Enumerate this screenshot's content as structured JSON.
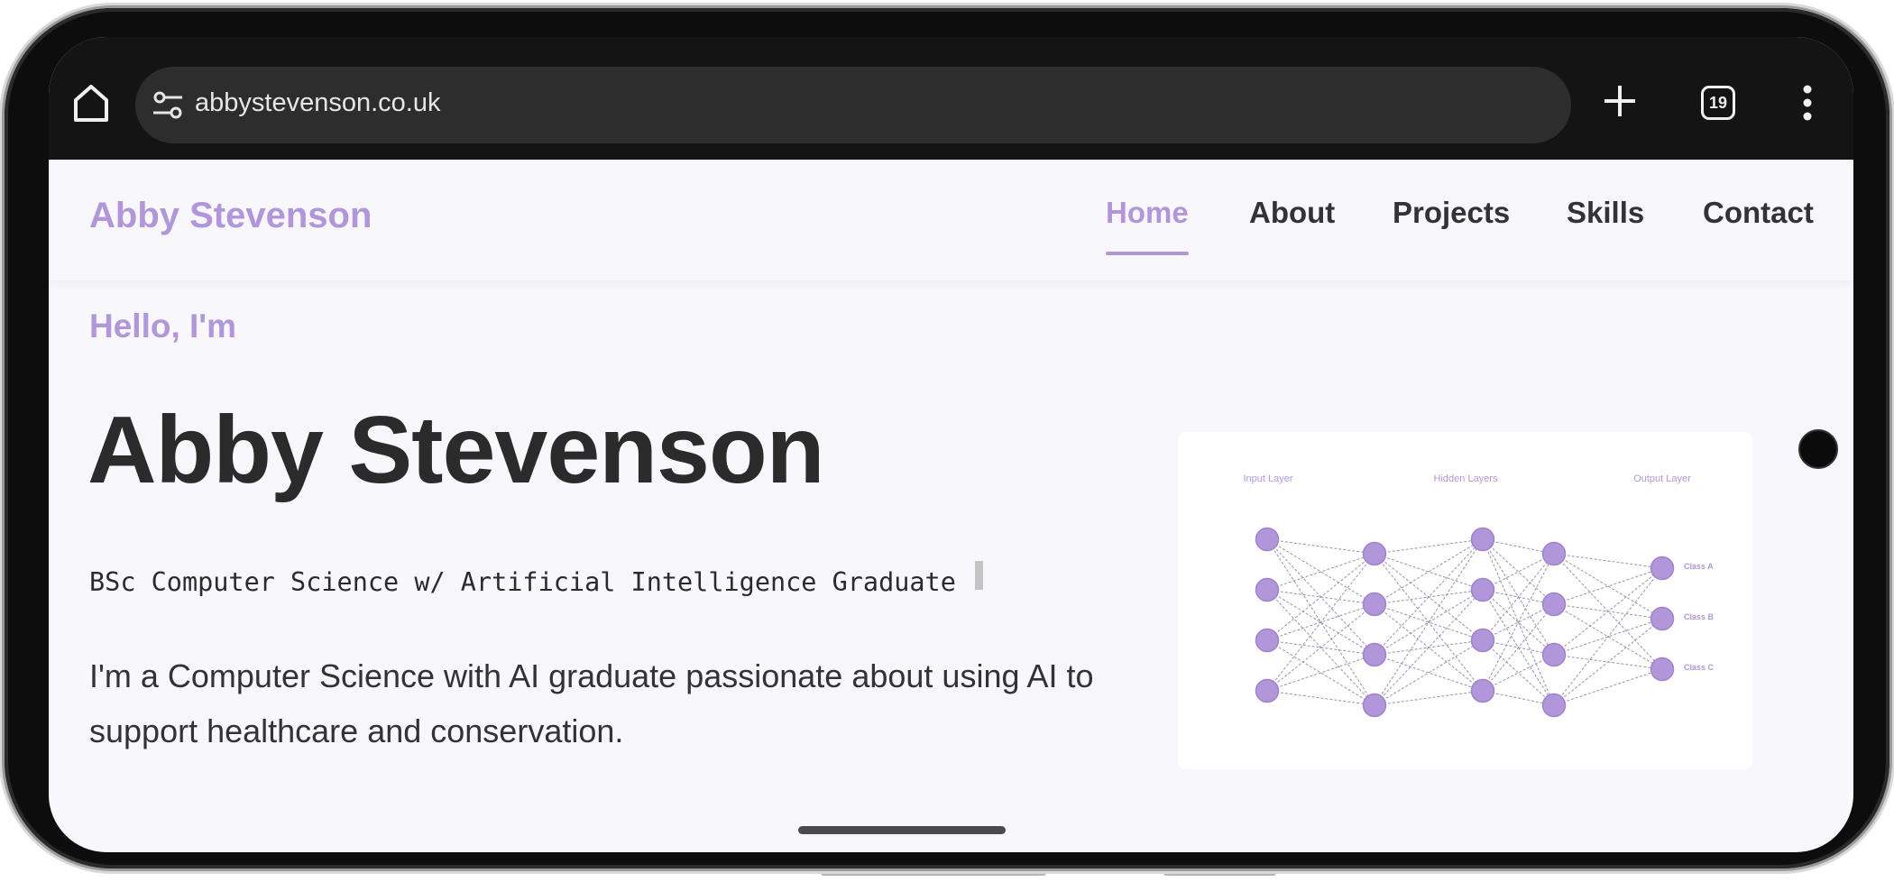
{
  "browser": {
    "url": "abbystevenson.co.uk",
    "tab_count": "19",
    "icons": [
      "home-icon",
      "tune-icon",
      "plus-icon",
      "tabs-icon",
      "more-vert-icon"
    ]
  },
  "site": {
    "brand": "Abby Stevenson",
    "nav": [
      {
        "label": "Home",
        "active": true
      },
      {
        "label": "About",
        "active": false
      },
      {
        "label": "Projects",
        "active": false
      },
      {
        "label": "Skills",
        "active": false
      },
      {
        "label": "Contact",
        "active": false
      }
    ]
  },
  "hero": {
    "greeting": "Hello, I'm",
    "name": "Abby Stevenson",
    "subtitle": "BSc Computer Science w/ Artificial Intelligence Graduate",
    "description": "I'm a Computer Science with AI graduate passionate about using AI to support healthcare and conservation."
  },
  "network": {
    "input_label": "Input Layer",
    "hidden_label": "Hidden Layers",
    "output_label": "Output Layer",
    "classes": [
      "Class A",
      "Class B",
      "Class C"
    ],
    "layer_sizes": [
      4,
      4,
      4,
      4,
      3
    ],
    "node_color": "#b197d9",
    "edge_color": "#8a8fa6"
  },
  "colors": {
    "accent": "#b197d9",
    "text": "#2b2b2b",
    "page_bg": "#f7f7fc",
    "toolbar_bg": "#141414"
  }
}
